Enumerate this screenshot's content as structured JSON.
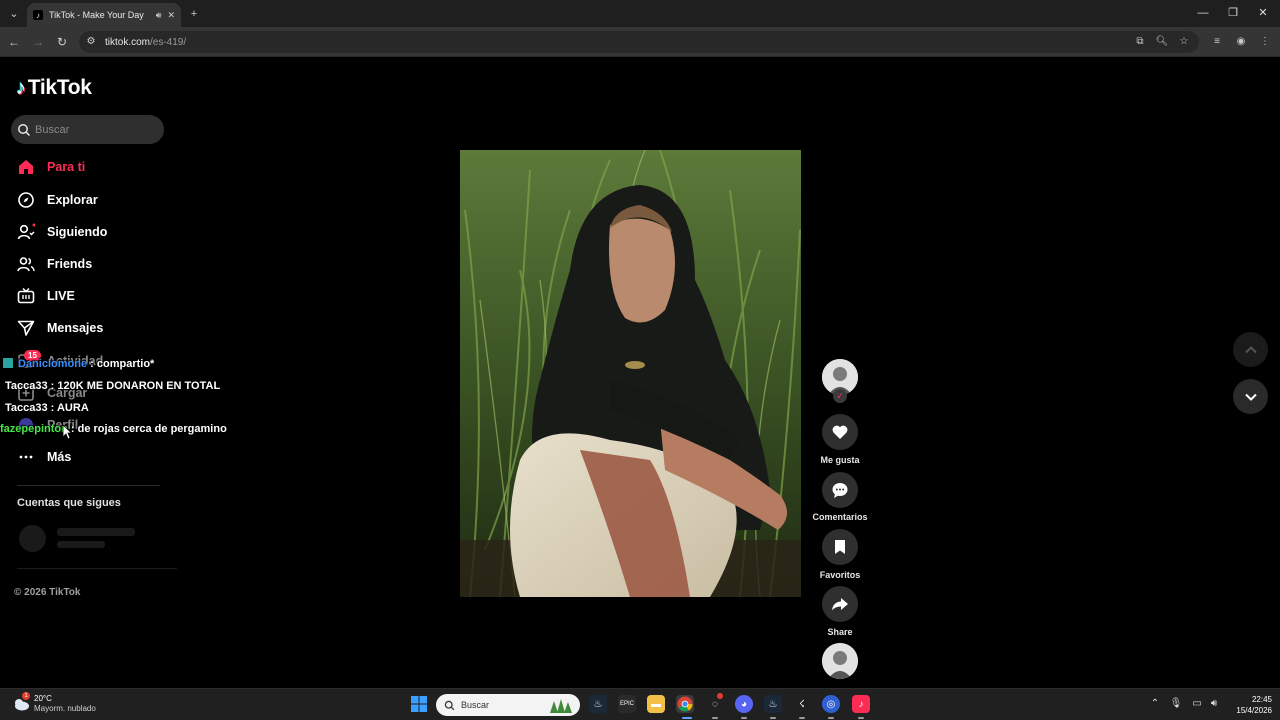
{
  "browser": {
    "tab_title": "TikTok - Make Your Day",
    "url_host": "tiktok.com",
    "url_path": "/es-419/"
  },
  "sidebar": {
    "logo": "TikTok",
    "search_placeholder": "Buscar",
    "nav": [
      {
        "label": "Para ti",
        "icon": "home-icon"
      },
      {
        "label": "Explorar",
        "icon": "compass-icon"
      },
      {
        "label": "Siguiendo",
        "icon": "following-icon"
      },
      {
        "label": "Friends",
        "icon": "friends-icon"
      },
      {
        "label": "LIVE",
        "icon": "live-tv-icon"
      },
      {
        "label": "Mensajes",
        "icon": "paper-plane-icon"
      },
      {
        "label": "Actividad",
        "icon": "inbox-icon",
        "badge": "15"
      },
      {
        "label": "Cargar",
        "icon": "plus-square-icon"
      },
      {
        "label": "Perfil",
        "icon": "profile-icon"
      },
      {
        "label": "Más",
        "icon": "more-dots-icon"
      }
    ],
    "following_title": "Cuentas que sigues",
    "copyright": "© 2026 TikTok"
  },
  "chat_overlay": [
    {
      "user": "Daniclomone",
      "message": ": compartio*",
      "color": "#3a8cff"
    },
    {
      "user": "Tacca33",
      "message": ": 120K ME DONARON EN TOTAL",
      "color": "#ffffff"
    },
    {
      "user": "Tacca33",
      "message": ": AURA",
      "color": "#ffffff"
    },
    {
      "user": "fazepepinton",
      "message": ": de rojas cerca de pergamino",
      "color": "#46e646"
    }
  ],
  "actions": {
    "like_label": "Me gusta",
    "comments_label": "Comentarios",
    "favorites_label": "Favoritos",
    "share_label": "Share"
  },
  "taskbar": {
    "weather_temp": "20°C",
    "weather_cond": "Mayorm. nublado",
    "weather_badge": "1",
    "search_placeholder": "Buscar",
    "time": "22:45",
    "date": "15/4/2026"
  },
  "colors": {
    "accent": "#fe2c55",
    "background": "#000000"
  }
}
